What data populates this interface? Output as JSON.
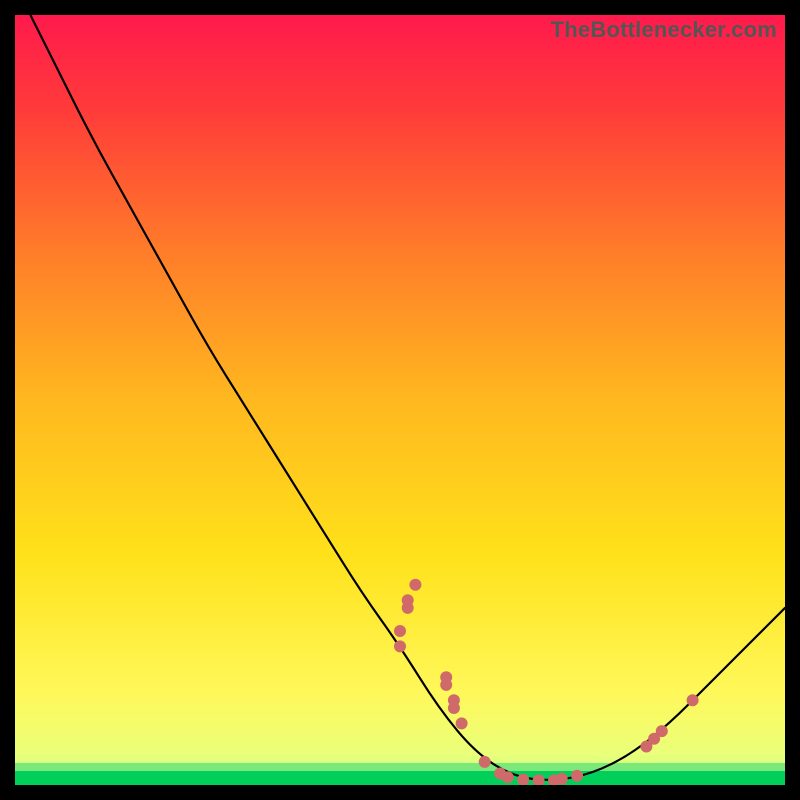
{
  "watermark": "TheBottlenecker.com",
  "chart_data": {
    "type": "line",
    "title": "",
    "xlabel": "",
    "ylabel": "",
    "xlim": [
      0,
      100
    ],
    "ylim": [
      0,
      100
    ],
    "background_gradient": {
      "top": "#ff1a4d",
      "mid": "#ffd200",
      "bottom_band": "#00d05a"
    },
    "curve": [
      {
        "x": 2,
        "y": 100
      },
      {
        "x": 5,
        "y": 94
      },
      {
        "x": 10,
        "y": 84
      },
      {
        "x": 15,
        "y": 75
      },
      {
        "x": 20,
        "y": 66
      },
      {
        "x": 25,
        "y": 57
      },
      {
        "x": 30,
        "y": 49
      },
      {
        "x": 35,
        "y": 41
      },
      {
        "x": 40,
        "y": 33
      },
      {
        "x": 45,
        "y": 25
      },
      {
        "x": 50,
        "y": 18
      },
      {
        "x": 55,
        "y": 10
      },
      {
        "x": 60,
        "y": 4
      },
      {
        "x": 65,
        "y": 1
      },
      {
        "x": 70,
        "y": 0.5
      },
      {
        "x": 75,
        "y": 1.5
      },
      {
        "x": 80,
        "y": 4
      },
      {
        "x": 85,
        "y": 8
      },
      {
        "x": 90,
        "y": 13
      },
      {
        "x": 95,
        "y": 18
      },
      {
        "x": 100,
        "y": 23
      }
    ],
    "markers": [
      {
        "x": 50,
        "y": 18
      },
      {
        "x": 50,
        "y": 20
      },
      {
        "x": 51,
        "y": 23
      },
      {
        "x": 51,
        "y": 24
      },
      {
        "x": 52,
        "y": 26
      },
      {
        "x": 56,
        "y": 13
      },
      {
        "x": 56,
        "y": 14
      },
      {
        "x": 57,
        "y": 10
      },
      {
        "x": 57,
        "y": 11
      },
      {
        "x": 58,
        "y": 8
      },
      {
        "x": 61,
        "y": 3
      },
      {
        "x": 63,
        "y": 1.5
      },
      {
        "x": 64,
        "y": 1
      },
      {
        "x": 66,
        "y": 0.7
      },
      {
        "x": 68,
        "y": 0.6
      },
      {
        "x": 70,
        "y": 0.6
      },
      {
        "x": 71,
        "y": 0.8
      },
      {
        "x": 73,
        "y": 1.2
      },
      {
        "x": 82,
        "y": 5
      },
      {
        "x": 83,
        "y": 6
      },
      {
        "x": 84,
        "y": 7
      },
      {
        "x": 88,
        "y": 11
      }
    ],
    "marker_color": "#d06a6a",
    "curve_color": "#000000"
  }
}
